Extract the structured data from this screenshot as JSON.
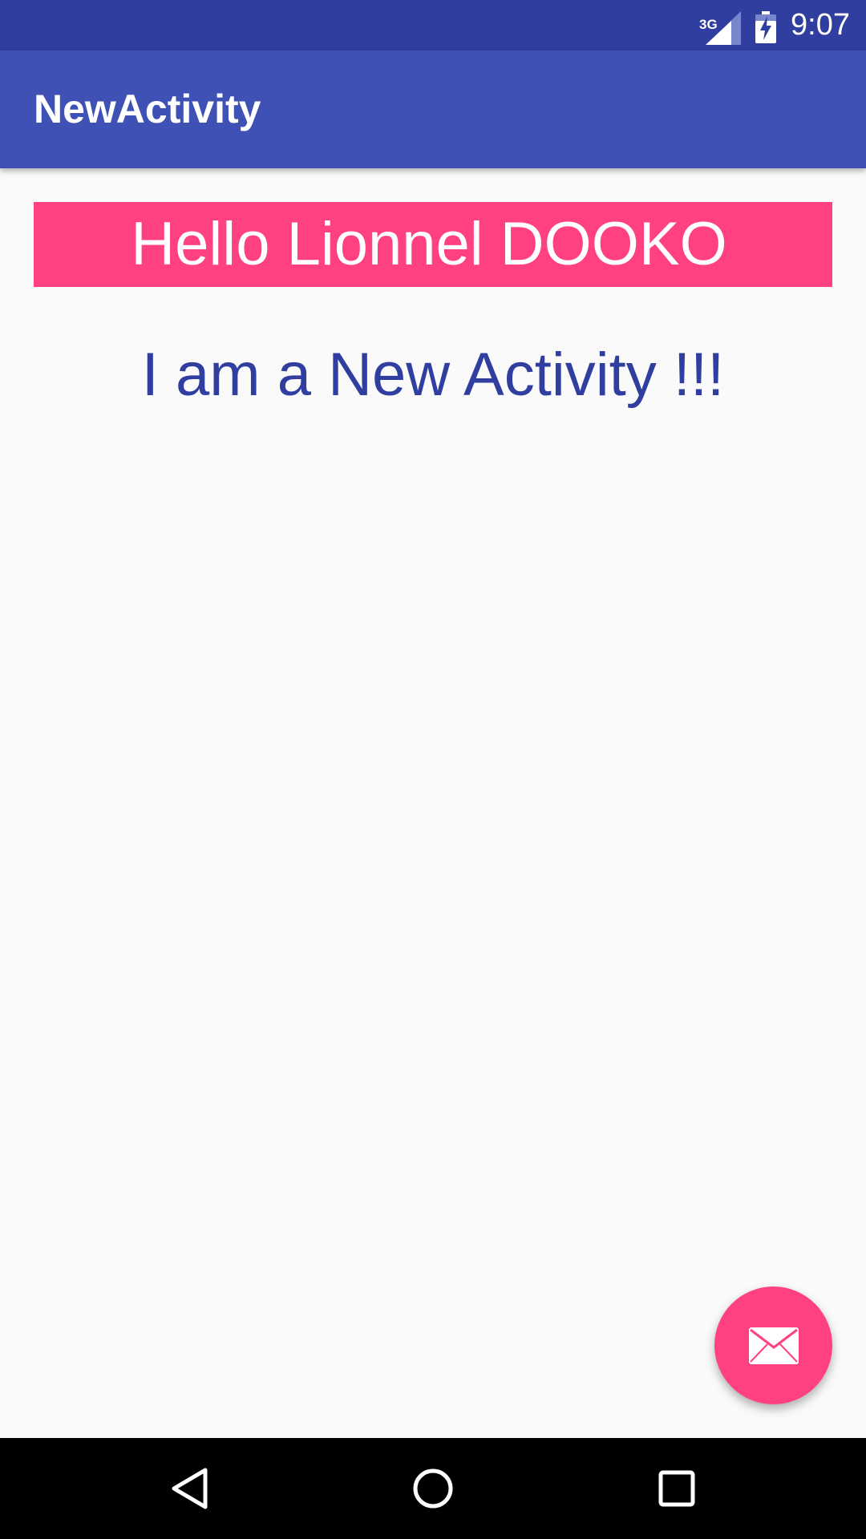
{
  "status_bar": {
    "network_label": "3G",
    "time": "9:07",
    "icons": [
      "signal-icon",
      "battery-charging-icon"
    ]
  },
  "app_bar": {
    "title": "NewActivity"
  },
  "content": {
    "greeting": "Hello Lionnel DOOKO",
    "message": "I am a New Activity !!!"
  },
  "fab": {
    "icon": "mail-icon"
  },
  "nav_bar": {
    "icons": [
      "back-icon",
      "home-icon",
      "recents-icon"
    ]
  },
  "colors": {
    "status_bar": "#303f9f",
    "app_bar": "#3f51b5",
    "accent": "#ff4081",
    "message_text": "#303f9f",
    "background": "#fafafa"
  }
}
